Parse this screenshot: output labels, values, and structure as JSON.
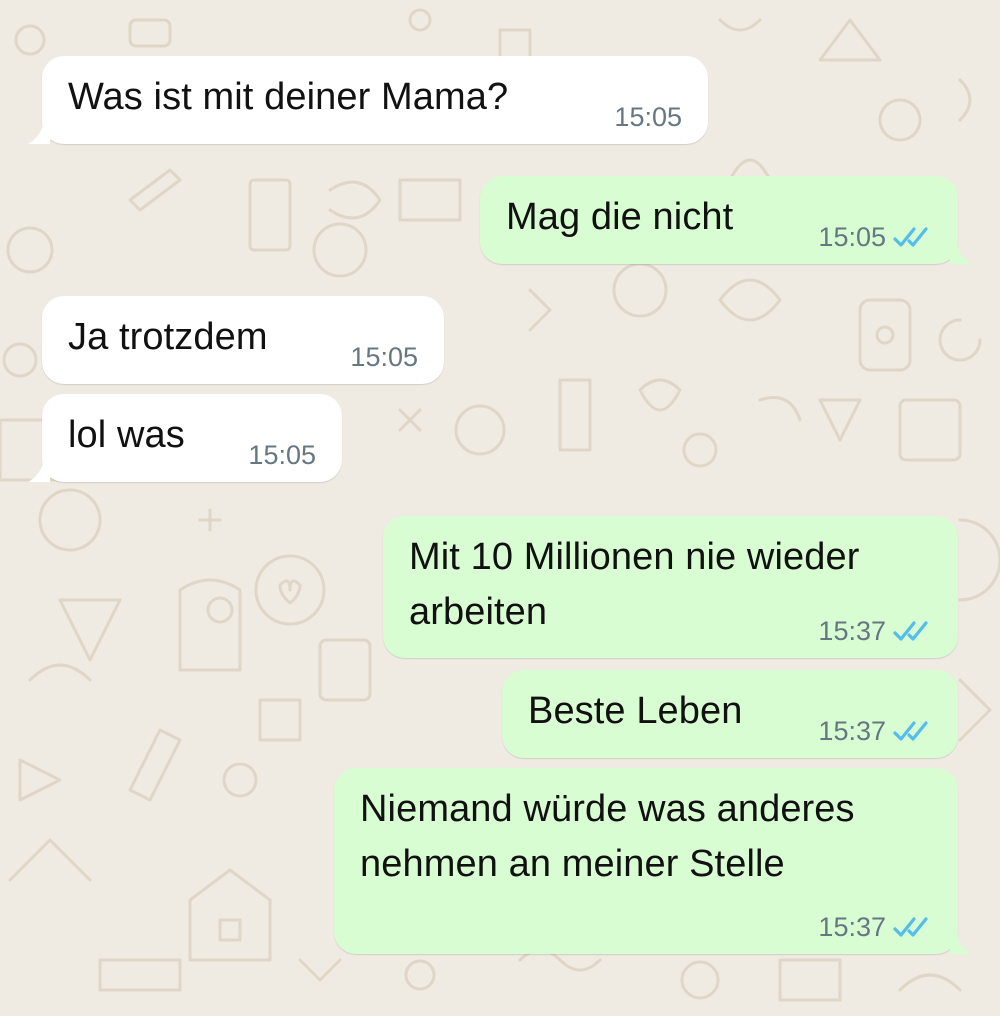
{
  "theme": {
    "wallpaper_color": "#efeae2",
    "incoming_bubble_color": "#ffffff",
    "outgoing_bubble_color": "#d9fdd3",
    "read_ticks_color": "#53bdeb",
    "time_color": "#667781"
  },
  "messages": [
    {
      "direction": "incoming",
      "text": "Was ist mit deiner Mama?",
      "time": "15:05"
    },
    {
      "direction": "outgoing",
      "text": "Mag die nicht",
      "time": "15:05",
      "status": "read"
    },
    {
      "direction": "incoming",
      "text": "Ja trotzdem",
      "time": "15:05"
    },
    {
      "direction": "incoming",
      "text": "lol was",
      "time": "15:05"
    },
    {
      "direction": "outgoing",
      "lines": [
        "Mit 10 Millionen nie wieder",
        "arbeiten"
      ],
      "time": "15:37",
      "status": "read"
    },
    {
      "direction": "outgoing",
      "text": "Beste Leben",
      "time": "15:37",
      "status": "read"
    },
    {
      "direction": "outgoing",
      "lines": [
        "Niemand würde was anderes",
        "nehmen an meiner Stelle"
      ],
      "time": "15:37",
      "status": "read"
    }
  ]
}
